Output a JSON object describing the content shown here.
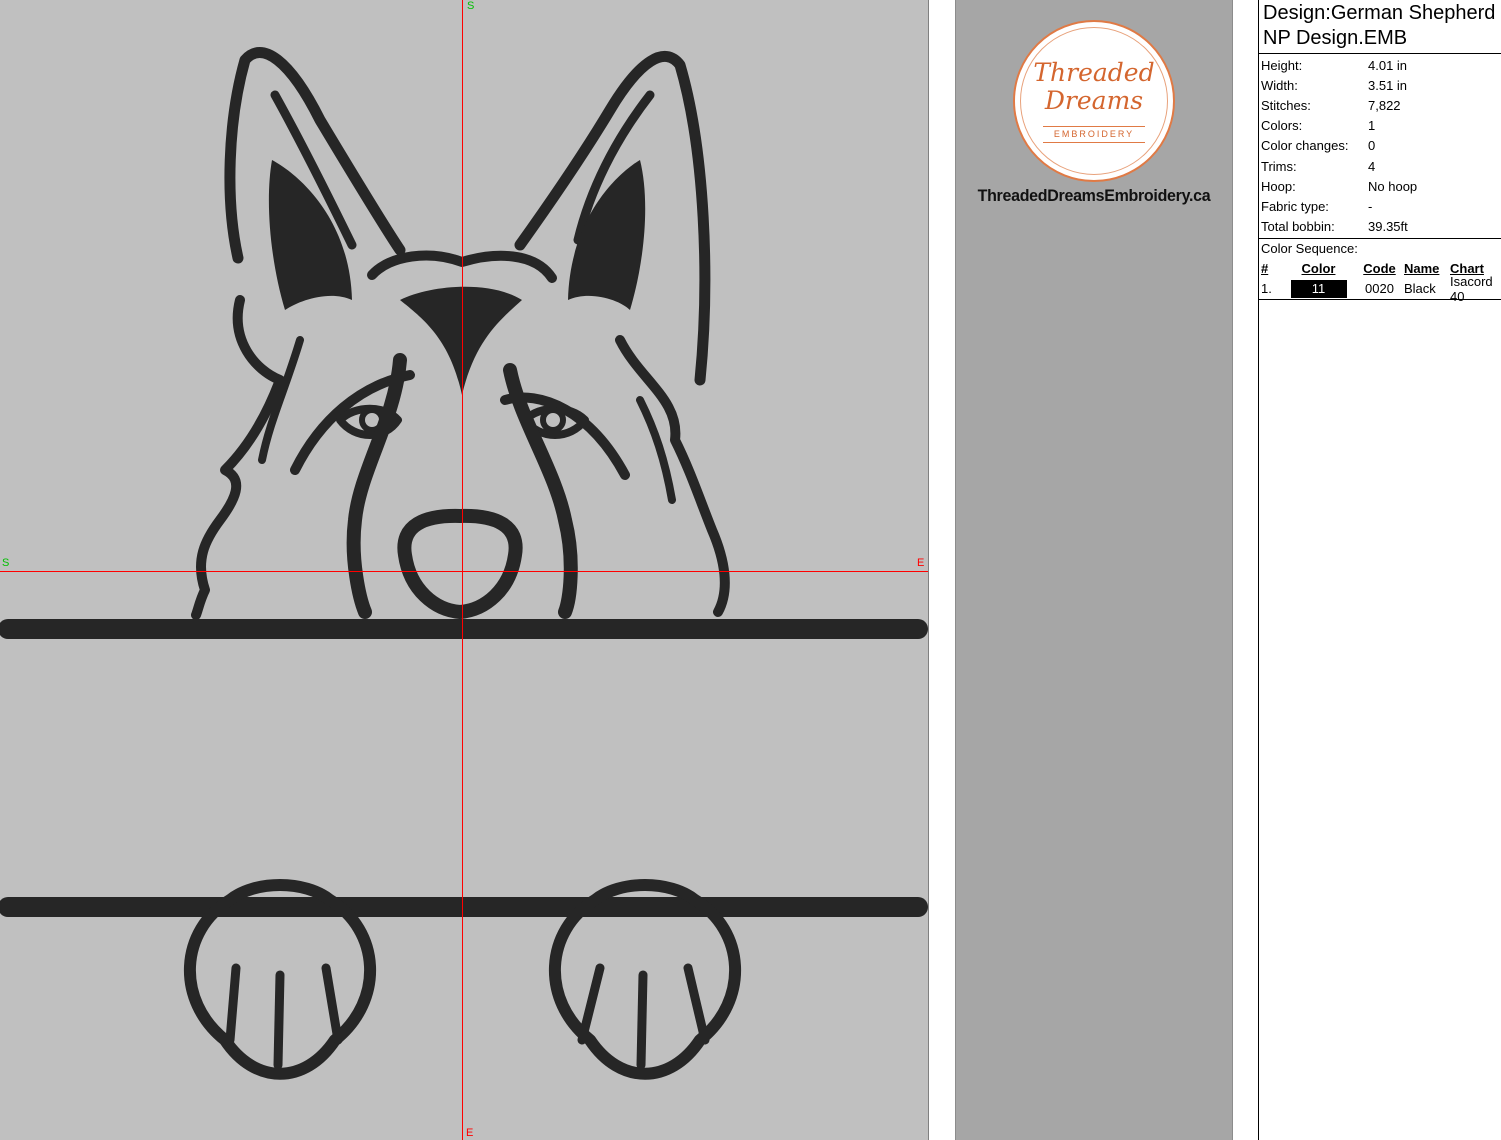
{
  "canvas": {
    "background": "#c0c0c0",
    "crosshair_color": "#ff0000",
    "marks": {
      "top_start": "S",
      "left_start": "S",
      "right_end": "E",
      "bottom_end": "E"
    }
  },
  "logo": {
    "line1": "Threaded",
    "line2": "Dreams",
    "line3": "EMBROIDERY",
    "accent_color": "#d4662f",
    "website": "ThreadedDreamsEmbroidery.ca"
  },
  "info": {
    "design_title": "Design:German Shepherd NP Design.EMB",
    "stats": [
      {
        "label": "Height:",
        "value": "4.01 in"
      },
      {
        "label": "Width:",
        "value": "3.51 in"
      },
      {
        "label": "Stitches:",
        "value": "7,822"
      },
      {
        "label": "Colors:",
        "value": "1"
      },
      {
        "label": "Color changes:",
        "value": "0"
      },
      {
        "label": "Trims:",
        "value": "4"
      },
      {
        "label": "Hoop:",
        "value": "No hoop"
      },
      {
        "label": "Fabric type:",
        "value": "-"
      },
      {
        "label": "Total bobbin:",
        "value": "39.35ft"
      }
    ],
    "color_sequence_label": "Color Sequence:",
    "color_sequence_headers": {
      "num": "#",
      "color": "Color",
      "code": "Code",
      "name": "Name",
      "chart": "Chart"
    },
    "color_sequence": [
      {
        "num": "1.",
        "color": "11",
        "swatch": "#000000",
        "code": "0020",
        "name": "Black",
        "chart": "Isacord 40"
      }
    ]
  }
}
